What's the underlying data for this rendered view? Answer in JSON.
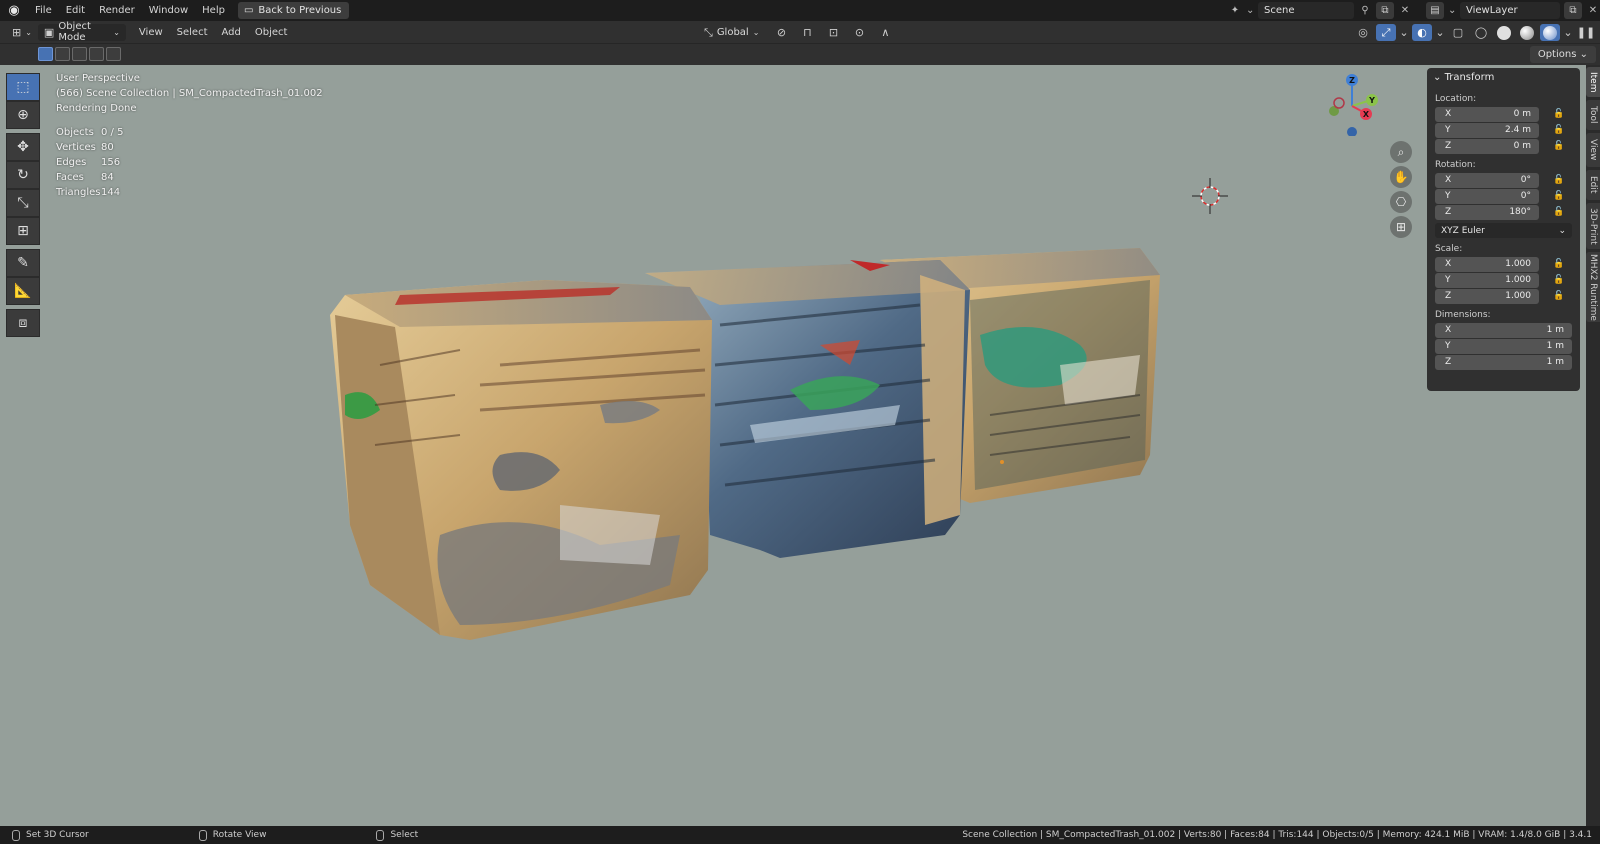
{
  "topbar": {
    "menu": [
      "File",
      "Edit",
      "Render",
      "Window",
      "Help"
    ],
    "back_button": "Back to Previous",
    "scene": "Scene",
    "view_layer": "ViewLayer"
  },
  "header": {
    "mode": "Object Mode",
    "menus": [
      "View",
      "Select",
      "Add",
      "Object"
    ],
    "orientation": "Global"
  },
  "toolrow": {
    "options": "Options"
  },
  "overlay": {
    "perspective": "User Perspective",
    "collection": "(566) Scene Collection | SM_CompactedTrash_01.002",
    "status": "Rendering Done",
    "stats": [
      {
        "label": "Objects",
        "value": "0 / 5"
      },
      {
        "label": "Vertices",
        "value": "80"
      },
      {
        "label": "Edges",
        "value": "156"
      },
      {
        "label": "Faces",
        "value": "84"
      },
      {
        "label": "Triangles",
        "value": "144"
      }
    ]
  },
  "gizmo": {
    "x": "X",
    "y": "Y",
    "z": "Z"
  },
  "npanel": {
    "title": "Transform",
    "location_label": "Location:",
    "location": [
      {
        "axis": "X",
        "value": "0 m"
      },
      {
        "axis": "Y",
        "value": "2.4 m"
      },
      {
        "axis": "Z",
        "value": "0 m"
      }
    ],
    "rotation_label": "Rotation:",
    "rotation": [
      {
        "axis": "X",
        "value": "0°"
      },
      {
        "axis": "Y",
        "value": "0°"
      },
      {
        "axis": "Z",
        "value": "180°"
      }
    ],
    "rotation_mode": "XYZ Euler",
    "scale_label": "Scale:",
    "scale": [
      {
        "axis": "X",
        "value": "1.000"
      },
      {
        "axis": "Y",
        "value": "1.000"
      },
      {
        "axis": "Z",
        "value": "1.000"
      }
    ],
    "dimensions_label": "Dimensions:",
    "dimensions": [
      {
        "axis": "X",
        "value": "1 m"
      },
      {
        "axis": "Y",
        "value": "1 m"
      },
      {
        "axis": "Z",
        "value": "1 m"
      }
    ]
  },
  "side_tabs": [
    "Item",
    "Tool",
    "View",
    "Edit",
    "3D-Print",
    "MHX2 Runtime"
  ],
  "statusbar": {
    "left": [
      "Set 3D Cursor",
      "Rotate View",
      "Select"
    ],
    "right": "Scene Collection | SM_CompactedTrash_01.002 | Verts:80 | Faces:84 | Tris:144 | Objects:0/5 | Memory: 424.1 MiB | VRAM: 1.4/8.0 GiB | 3.4.1"
  },
  "colors": {
    "viewport_bg": "#959f9a",
    "accent": "#4772b3",
    "axis_x": "#e53b52",
    "axis_y": "#8bc34a",
    "axis_z": "#3f7fd6"
  }
}
